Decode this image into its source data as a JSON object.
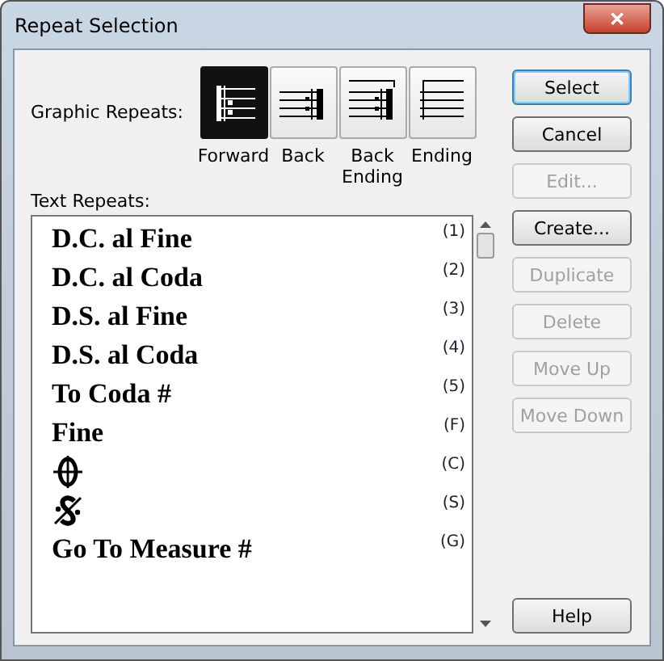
{
  "window": {
    "title": "Repeat Selection",
    "close": "✕"
  },
  "graphic_repeats": {
    "label": "Graphic Repeats:",
    "items": [
      {
        "kind": "forward",
        "label": "Forward",
        "selected": true
      },
      {
        "kind": "back",
        "label": "Back",
        "selected": false
      },
      {
        "kind": "back_ending",
        "label": "Back Ending",
        "selected": false
      },
      {
        "kind": "ending",
        "label": "Ending",
        "selected": false
      }
    ]
  },
  "text_repeats": {
    "label": "Text Repeats:",
    "items": [
      {
        "kind": "text",
        "text": "D.C. al Fine",
        "key": "(1)"
      },
      {
        "kind": "text",
        "text": "D.C. al Coda",
        "key": "(2)"
      },
      {
        "kind": "text",
        "text": "D.S. al Fine",
        "key": "(3)"
      },
      {
        "kind": "text",
        "text": "D.S. al Coda",
        "key": "(4)"
      },
      {
        "kind": "text",
        "text": "To Coda #",
        "key": "(5)"
      },
      {
        "kind": "text",
        "text": "Fine",
        "key": "(F)"
      },
      {
        "kind": "coda",
        "key": "(C)"
      },
      {
        "kind": "segno",
        "key": "(S)"
      },
      {
        "kind": "text",
        "text": "Go To Measure #",
        "key": "(G)"
      }
    ]
  },
  "buttons": [
    {
      "label": "Select",
      "disabled": false,
      "default": true
    },
    {
      "label": "Cancel",
      "disabled": false,
      "default": false
    },
    {
      "label": "Edit...",
      "disabled": true,
      "default": false
    },
    {
      "label": "Create...",
      "disabled": false,
      "default": false
    },
    {
      "label": "Duplicate",
      "disabled": true,
      "default": false
    },
    {
      "label": "Delete",
      "disabled": true,
      "default": false
    },
    {
      "label": "Move Up",
      "disabled": true,
      "default": false
    },
    {
      "label": "Move Down",
      "disabled": true,
      "default": false
    }
  ],
  "help_button": {
    "label": "Help"
  }
}
